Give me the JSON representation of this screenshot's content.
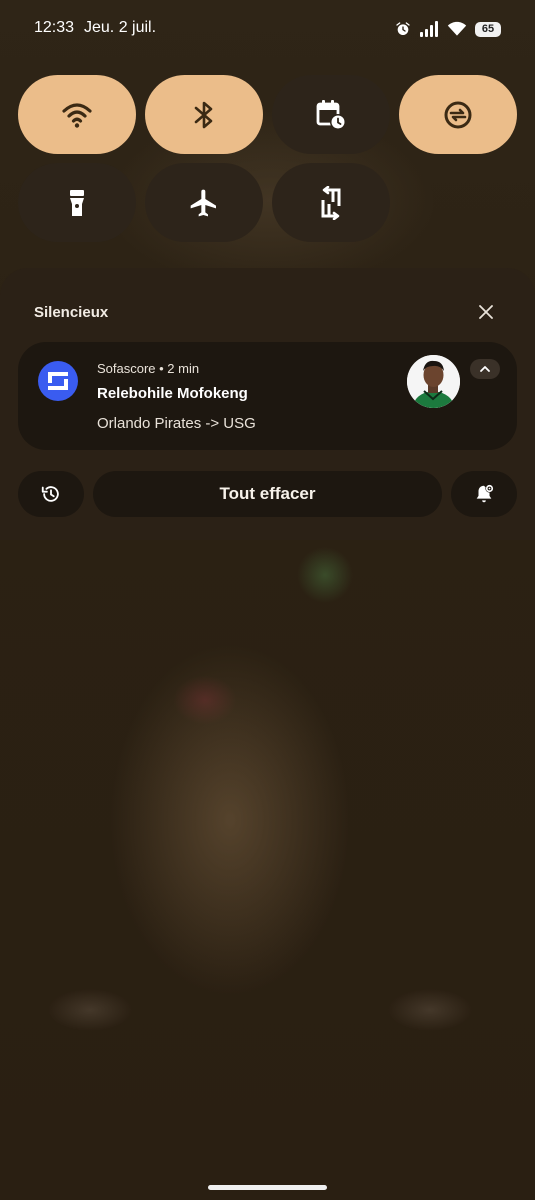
{
  "status_bar": {
    "time": "12:33",
    "date": "Jeu. 2 juil.",
    "battery": "65",
    "icons": [
      "alarm-icon",
      "signal-icon",
      "wifi-icon",
      "battery-icon"
    ]
  },
  "quick_settings": {
    "tiles": [
      {
        "name": "wifi",
        "icon": "wifi-icon",
        "state": "on"
      },
      {
        "name": "bluetooth",
        "icon": "bluetooth-icon",
        "state": "on"
      },
      {
        "name": "schedule",
        "icon": "calendar-clock-icon",
        "state": "off"
      },
      {
        "name": "data-saver",
        "icon": "data-saver-icon",
        "state": "on"
      },
      {
        "name": "flashlight",
        "icon": "flashlight-icon",
        "state": "off"
      },
      {
        "name": "airplane-mode",
        "icon": "airplane-icon",
        "state": "off"
      },
      {
        "name": "auto-rotate",
        "icon": "rotate-icon",
        "state": "off"
      }
    ]
  },
  "notifications": {
    "section_title": "Silencieux",
    "items": [
      {
        "app_line": "Sofascore • 2 min",
        "title": "Relebohile Mofokeng",
        "text": "Orlando Pirates -> USG",
        "icon": "sofascore-icon"
      }
    ]
  },
  "actions": {
    "clear_all": "Tout effacer"
  },
  "colors": {
    "tile_on": "#ebbd8a",
    "tile_off": "#2d241a",
    "notification_bg": "#1d1710",
    "sofascore_blue": "#3a5cf0"
  }
}
